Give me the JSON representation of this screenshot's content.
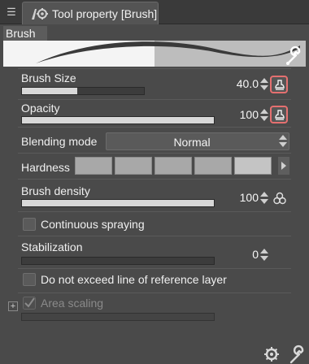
{
  "window": {
    "tab_menu_icon": "panel-menu-icon",
    "tab_title": "Tool property [Brush]"
  },
  "preview": {
    "label": "Brush"
  },
  "properties": {
    "brush_size": {
      "label": "Brush Size",
      "value": "40.0",
      "level": 0.45
    },
    "opacity": {
      "label": "Opacity",
      "value": "100",
      "level": 1.0
    },
    "blending_mode": {
      "label": "Blending mode",
      "value": "Normal"
    },
    "hardness": {
      "label": "Hardness"
    },
    "brush_density": {
      "label": "Brush density",
      "value": "100",
      "level": 1.0
    },
    "continuous_spraying": {
      "label": "Continuous spraying",
      "checked": false
    },
    "stabilization": {
      "label": "Stabilization",
      "value": "0",
      "level": 0.0
    },
    "reference_layer": {
      "label": "Do not exceed line of reference layer",
      "checked": false
    },
    "area_scaling": {
      "label": "Area scaling",
      "checked": true,
      "disabled": true
    }
  },
  "colors": {
    "highlight": "#e57070",
    "background": "#4a4a4a"
  }
}
